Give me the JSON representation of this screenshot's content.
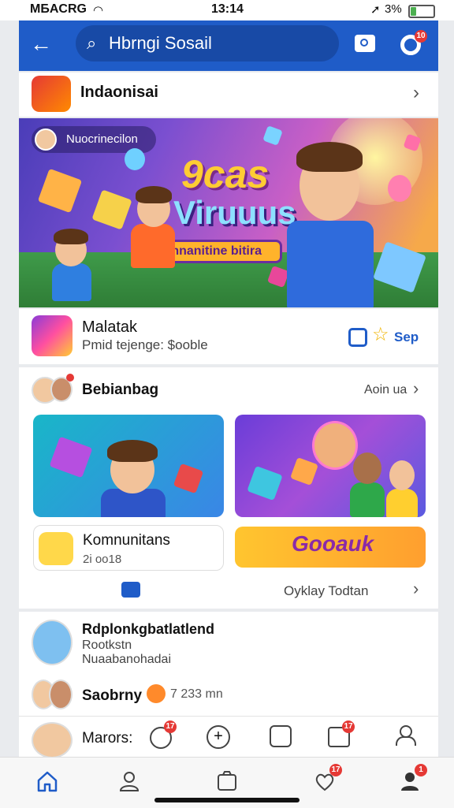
{
  "status_bar": {
    "carrier": "MБACRG",
    "time": "13:14",
    "battery_text": "3%",
    "battery_level_percent": 25
  },
  "appbar": {
    "search_text": "Hbrngi Sosail",
    "search_icon": "search-icon",
    "back_icon": "arrow-left-icon",
    "camera_icon": "camera-icon",
    "notif_badge": "10"
  },
  "section_indo": {
    "title": "Indaonisai"
  },
  "banner": {
    "pill_text": "Nuocrinecilon",
    "logo_line1": "9cas",
    "logo_line2": "Viruuus",
    "logo_sub": "Konnanitine bitira"
  },
  "featured_app": {
    "name": "Malatak",
    "subtitle": "Pmid tejenge: $ooble",
    "action_label": "Sep"
  },
  "community": {
    "title": "Bebianbag",
    "see_all": "Aoin ua",
    "mini_card": {
      "name": "Komnunitans",
      "count": "2i oo18"
    },
    "promo_text": "Gooauk",
    "footer_link": "Oyklay Todtan"
  },
  "people": [
    {
      "name": "Rdplonkgbatlatlend",
      "line2": "Rootkstn",
      "line3": "Nuaabanohadai"
    },
    {
      "name": "Saobrny",
      "extra": "7 233 mn"
    },
    {
      "name": "Marors:",
      "extra": ""
    }
  ],
  "action_row_badges": [
    "17",
    "17"
  ],
  "bottom_nav": {
    "items": [
      "home-icon",
      "profile-icon",
      "marketplace-icon",
      "notifications-icon",
      "menu-icon"
    ],
    "badges": [
      "17",
      "1"
    ],
    "accent": "#1f5cc8"
  }
}
